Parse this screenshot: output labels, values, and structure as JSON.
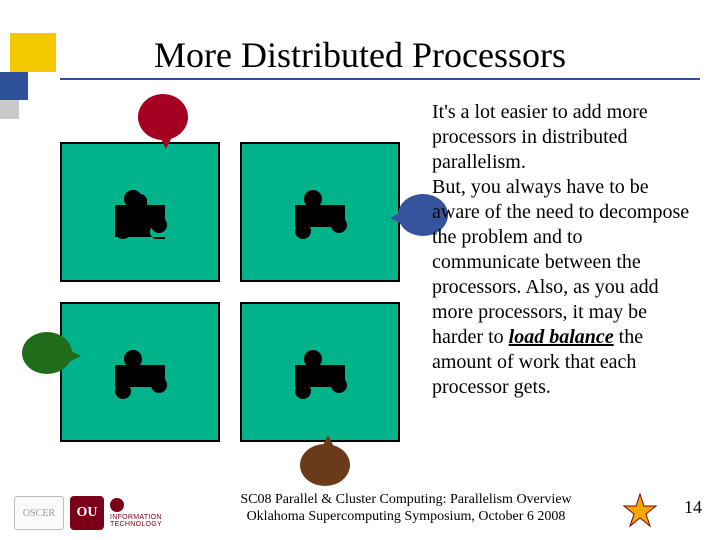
{
  "title": "More Distributed Processors",
  "paragraph": {
    "p1": "It's a lot easier to add more processors in distributed parallelism.",
    "p2": "But, you always have to be aware of the need to decompose the problem and to communicate between the processors. Also, as you add more processors, it may be harder to ",
    "load_balance": "load balance",
    "p3": " the amount of work that each processor gets."
  },
  "footer": {
    "line1": "SC08 Parallel & Cluster Computing: Parallelism Overview",
    "line2": "Oklahoma Supercomputing Symposium, October 6 2008",
    "page": "14",
    "logo_oscer": "OSCER",
    "logo_ou": "OU",
    "logo_it1": "INFORMATION",
    "logo_it2": "TECHNOLOGY"
  }
}
